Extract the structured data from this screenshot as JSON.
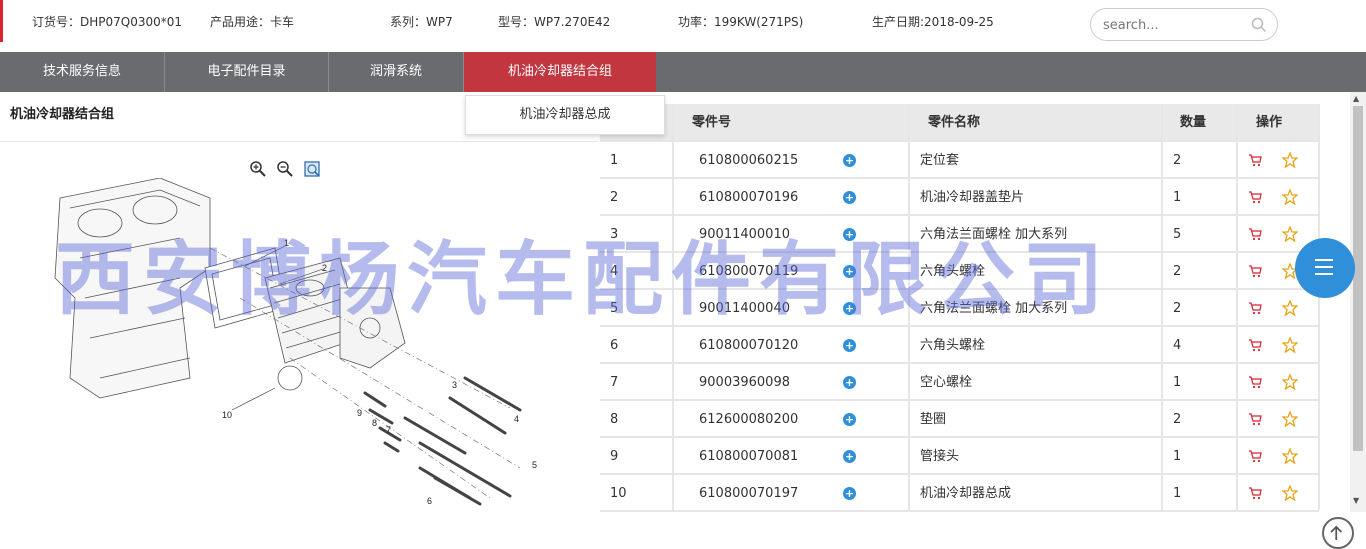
{
  "header": {
    "order_no": "订货号：DHP07Q0300*01",
    "usage": "产品用途：卡车",
    "series": "系列：WP7",
    "model": "型号：WP7.270E42",
    "power": "功率：199KW(271PS)",
    "date": "生产日期:2018-09-25",
    "search_placeholder": "search..."
  },
  "nav": {
    "tabs": [
      {
        "label": "技术服务信息"
      },
      {
        "label": "电子配件目录"
      },
      {
        "label": "润滑系统"
      },
      {
        "label": "机油冷却器结合组"
      }
    ],
    "dropdown_item": "机油冷却器总成"
  },
  "left": {
    "title": "机油冷却器结合组",
    "callouts": [
      "1",
      "2",
      "3",
      "4",
      "5",
      "6",
      "7",
      "8",
      "9",
      "10"
    ]
  },
  "table": {
    "headers": [
      "零件号",
      "零件名称",
      "数量",
      "操作"
    ],
    "rows": [
      {
        "no": "1",
        "part": "610800060215",
        "name": "定位套",
        "qty": "2"
      },
      {
        "no": "2",
        "part": "610800070196",
        "name": "机油冷却器盖垫片",
        "qty": "1"
      },
      {
        "no": "3",
        "part": "90011400010",
        "name": "六角法兰面螺栓 加大系列",
        "qty": "5"
      },
      {
        "no": "4",
        "part": "610800070119",
        "name": "六角头螺栓",
        "qty": "2"
      },
      {
        "no": "5",
        "part": "90011400040",
        "name": "六角法兰面螺栓 加大系列",
        "qty": "2"
      },
      {
        "no": "6",
        "part": "610800070120",
        "name": "六角头螺栓",
        "qty": "4"
      },
      {
        "no": "7",
        "part": "90003960098",
        "name": "空心螺栓",
        "qty": "1"
      },
      {
        "no": "8",
        "part": "612600080200",
        "name": "垫圈",
        "qty": "2"
      },
      {
        "no": "9",
        "part": "610800070081",
        "name": "管接头",
        "qty": "1"
      },
      {
        "no": "10",
        "part": "610800070197",
        "name": "机油冷却器总成",
        "qty": "1"
      }
    ]
  },
  "watermark": "西安博杨汽车配件有限公司",
  "colors": {
    "accent": "#c1363f",
    "nav_bg": "#696b6e",
    "blue": "#2f8fd8",
    "star": "#e8a317"
  },
  "icons": [
    "search-icon",
    "zoom-in-icon",
    "zoom-out-icon",
    "fit-icon",
    "plus-circle-icon",
    "cart-icon",
    "star-icon",
    "menu-icon",
    "arrow-up-icon"
  ]
}
